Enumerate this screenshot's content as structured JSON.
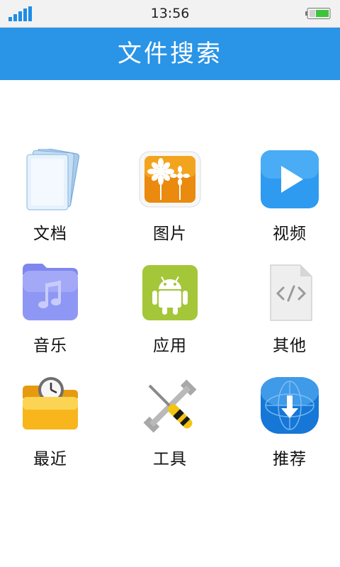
{
  "status_bar": {
    "time": "13:56",
    "signal_icon": "signal-bars-icon",
    "battery_icon": "battery-icon",
    "battery_level": 0.6,
    "accent": "#1e8de6",
    "battery_color": "#3ec43a"
  },
  "header": {
    "title": "文件搜索",
    "background": "#2a94e6"
  },
  "categories": [
    {
      "label": "文档",
      "icon": "document-stack-icon"
    },
    {
      "label": "图片",
      "icon": "picture-flowers-icon"
    },
    {
      "label": "视频",
      "icon": "video-play-icon"
    },
    {
      "label": "音乐",
      "icon": "music-folder-icon"
    },
    {
      "label": "应用",
      "icon": "android-robot-icon"
    },
    {
      "label": "其他",
      "icon": "code-file-icon"
    },
    {
      "label": "最近",
      "icon": "clock-folder-icon"
    },
    {
      "label": "工具",
      "icon": "wrench-screwdriver-icon"
    },
    {
      "label": "推荐",
      "icon": "globe-download-icon"
    }
  ]
}
